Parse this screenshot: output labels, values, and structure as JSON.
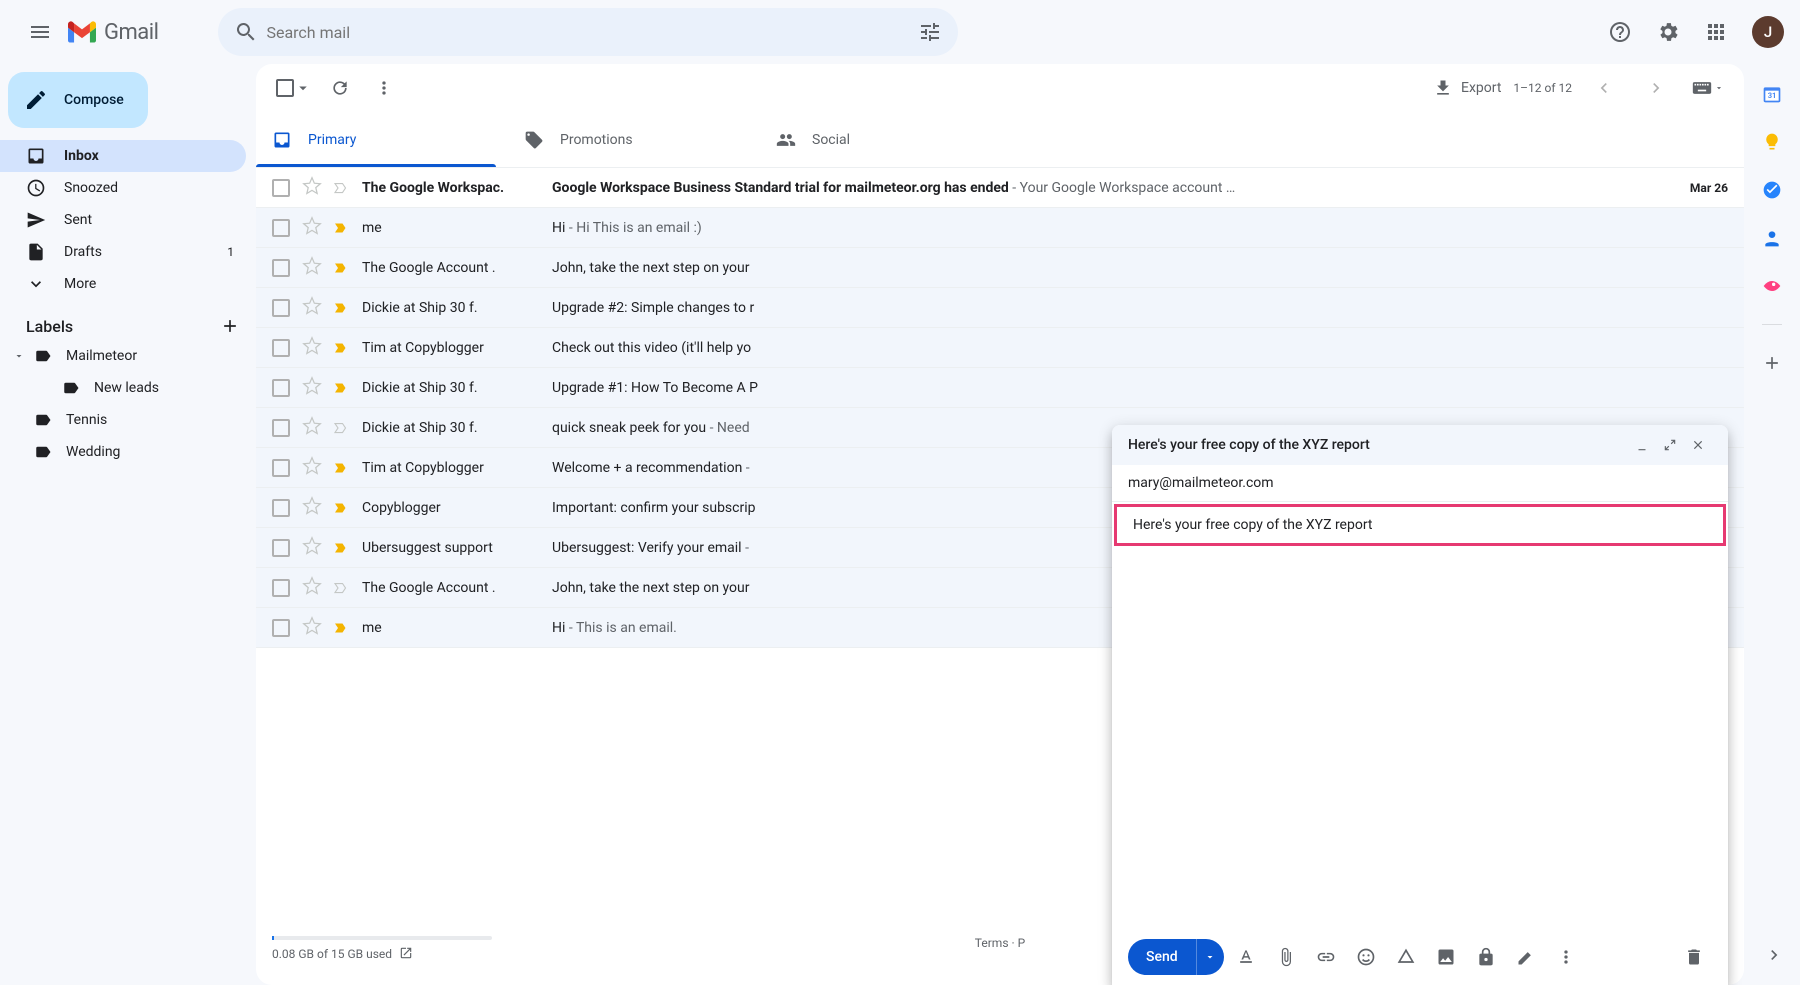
{
  "header": {
    "app_name": "Gmail",
    "search_placeholder": "Search mail",
    "avatar_initial": "J"
  },
  "sidebar": {
    "compose": "Compose",
    "nav": [
      {
        "label": "Inbox",
        "active": true
      },
      {
        "label": "Snoozed"
      },
      {
        "label": "Sent"
      },
      {
        "label": "Drafts",
        "count": "1"
      },
      {
        "label": "More"
      }
    ],
    "labels_header": "Labels",
    "labels": [
      {
        "label": "Mailmeteor",
        "expandable": true
      },
      {
        "label": "New leads",
        "indent": true
      },
      {
        "label": "Tennis"
      },
      {
        "label": "Wedding"
      }
    ]
  },
  "toolbar": {
    "export": "Export",
    "pagination": "1–12 of 12"
  },
  "tabs": [
    {
      "label": "Primary",
      "active": true
    },
    {
      "label": "Promotions"
    },
    {
      "label": "Social"
    }
  ],
  "emails": [
    {
      "sender": "The Google Workspac.",
      "subject": "Google Workspace Business Standard trial for mailmeteor.org has ended",
      "snippet": " - Your Google Workspace account …",
      "date": "Mar 26",
      "imp": false,
      "unread": true
    },
    {
      "sender": "me",
      "subject": "Hi",
      "snippet": " - Hi This is an email :)",
      "imp": true
    },
    {
      "sender": "The Google Account .",
      "subject": "John, take the next step on your",
      "snippet": "",
      "imp": true
    },
    {
      "sender": "Dickie at Ship 30 f.",
      "subject": "Upgrade #2: Simple changes to r",
      "snippet": "",
      "imp": true
    },
    {
      "sender": "Tim at Copyblogger",
      "subject": "Check out this video (it'll help yo",
      "snippet": "",
      "imp": true
    },
    {
      "sender": "Dickie at Ship 30 f.",
      "subject": "Upgrade #1: How To Become A P",
      "snippet": "",
      "imp": true
    },
    {
      "sender": "Dickie at Ship 30 f.",
      "subject": "quick sneak peek for you",
      "snippet": " - Need",
      "imp": false
    },
    {
      "sender": "Tim at Copyblogger",
      "subject": "Welcome + a recommendation",
      "snippet": " - ",
      "imp": true
    },
    {
      "sender": "Copyblogger",
      "subject": "Important: confirm your subscrip",
      "snippet": "",
      "imp": true
    },
    {
      "sender": "Ubersuggest support",
      "subject": "Ubersuggest: Verify your email",
      "snippet": " - ",
      "imp": true
    },
    {
      "sender": "The Google Account .",
      "subject": "John, take the next step on your",
      "snippet": "",
      "imp": false
    },
    {
      "sender": "me",
      "subject": "Hi",
      "snippet": " - This is an email.",
      "imp": true
    }
  ],
  "footer": {
    "storage": "0.08 GB of 15 GB used",
    "terms": "Terms",
    "sep": " · ",
    "privacy": "P"
  },
  "compose": {
    "title": "Here's your free copy of the XYZ report",
    "to": "mary@mailmeteor.com",
    "subject": "Here's your free copy of the XYZ report",
    "send": "Send"
  }
}
